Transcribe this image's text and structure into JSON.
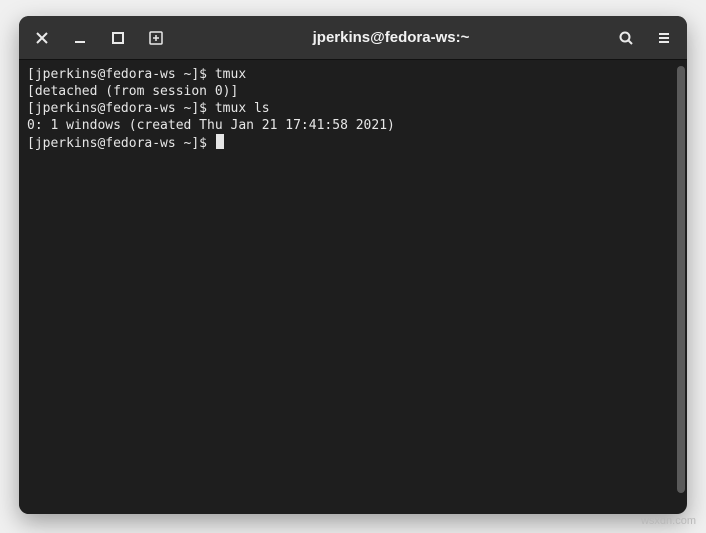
{
  "titlebar": {
    "title": "jperkins@fedora-ws:~"
  },
  "terminal": {
    "lines": [
      {
        "type": "cmd",
        "prompt": "[jperkins@fedora-ws ~]$ ",
        "input": "tmux"
      },
      {
        "type": "out",
        "text": "[detached (from session 0)]"
      },
      {
        "type": "cmd",
        "prompt": "[jperkins@fedora-ws ~]$ ",
        "input": "tmux ls"
      },
      {
        "type": "out",
        "text": "0: 1 windows (created Thu Jan 21 17:41:58 2021)"
      },
      {
        "type": "cmd",
        "prompt": "[jperkins@fedora-ws ~]$ ",
        "input": "",
        "cursor": true
      }
    ]
  },
  "watermark": "wsxdn.com"
}
